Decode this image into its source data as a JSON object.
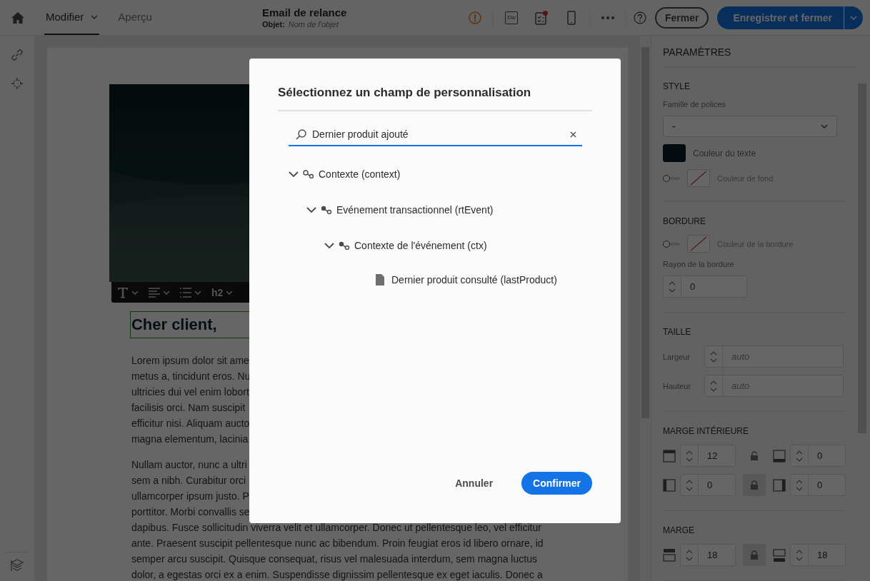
{
  "top_bar": {
    "tabs": [
      {
        "label": "Modifier",
        "selected": true,
        "has_menu": true
      },
      {
        "label": "Aperçu",
        "selected": false,
        "has_menu": false
      }
    ],
    "title": "Email de relance",
    "subject_label": "Objet:",
    "subject_placeholder": "Nom de l'objet",
    "editor_badge": "Dw",
    "checklist_alert": true,
    "close_button": "Fermer",
    "save_button": "Enregistrer et fermer"
  },
  "editor": {
    "toolbar": {
      "heading_level": "h2"
    },
    "heading": "Cher client,",
    "heading_selected": true,
    "paragraphs": [
      {
        "lines": [
          "Lorem ipsum dolor sit ame",
          "metus a, tincidunt eros. Nu",
          "ultricies dui vel enim lobort",
          "facilisis orci. Nam suscipit",
          "efficitur nisi. Aliquam aucto",
          "magna elementum, lacinia"
        ]
      },
      {
        "lines": [
          "Nullam auctor, nunc a ultri",
          "sem a nibh. Curabitur orci",
          "ullamcorper ipsum justo. P",
          "porttitor. Morbi convallis se",
          "dapibus. Fusce sollicitudin viverra velit et ullamcorper. Donec ut pellentesque leo, vel efficitur",
          "ante. Praesent suscipit pellentesque nunc ac bibendum. Proin feugiat eros id libero ornare, id",
          "semper arcu suscipit. Quisque consequat, risus vel malesuada interdum, sem magna luctus",
          "dolor, a egestas orci ex a enim. Suspendisse dignissim pellentesque ex eget iaculis. Donec a"
        ]
      }
    ]
  },
  "settings": {
    "title": "PARAMÈTRES",
    "sections": [
      {
        "title": "STYLE",
        "rows": [
          {
            "kind": "select",
            "label": "Famille de polices",
            "value": "-"
          },
          {
            "kind": "color",
            "label": "Couleur du texte"
          },
          {
            "kind": "color_toggle",
            "label": "Couleur de fond",
            "on": false
          }
        ]
      },
      {
        "title": "BORDURE",
        "rows": [
          {
            "kind": "color_toggle",
            "label": "Couleur de la bordure",
            "on": false
          },
          {
            "kind": "spinner",
            "label": "Rayon de la bordure",
            "value": "0"
          }
        ]
      },
      {
        "title": "TAILLE",
        "rows": [
          {
            "kind": "size",
            "label": "Largeur",
            "placeholder": "auto"
          },
          {
            "kind": "size",
            "label": "Hauteur",
            "placeholder": "auto"
          }
        ]
      },
      {
        "title": "MARGE INTÉRIEURE",
        "rows": [
          {
            "kind": "padding_vertical",
            "first": "12",
            "locked": false,
            "second": "0"
          },
          {
            "kind": "padding_horizontal",
            "first": "0",
            "locked": true,
            "second": "0"
          }
        ]
      },
      {
        "title": "MARGE",
        "rows": [
          {
            "kind": "margin_vertical",
            "first": "18",
            "locked": true,
            "second": "18"
          }
        ]
      }
    ]
  },
  "dialog": {
    "title": "Sélectionnez un champ de personnalisation",
    "search": {
      "value": "Dernier produit ajouté"
    },
    "tree": [
      {
        "label": "Contexte (context)",
        "kind": "collection",
        "expanded": true,
        "children": [
          {
            "label": "Evénement transactionnel (rtEvent)",
            "kind": "link",
            "expanded": true,
            "children": [
              {
                "label": "Contexte de l'événement (ctx)",
                "kind": "link",
                "expanded": true,
                "children": [
                  {
                    "label": "Dernier produit consulté (lastProduct)",
                    "kind": "field"
                  }
                ]
              }
            ]
          }
        ]
      }
    ],
    "buttons": [
      {
        "label": "Annuler",
        "kind": "secondary"
      },
      {
        "label": "Confirmer",
        "kind": "primary"
      }
    ]
  }
}
